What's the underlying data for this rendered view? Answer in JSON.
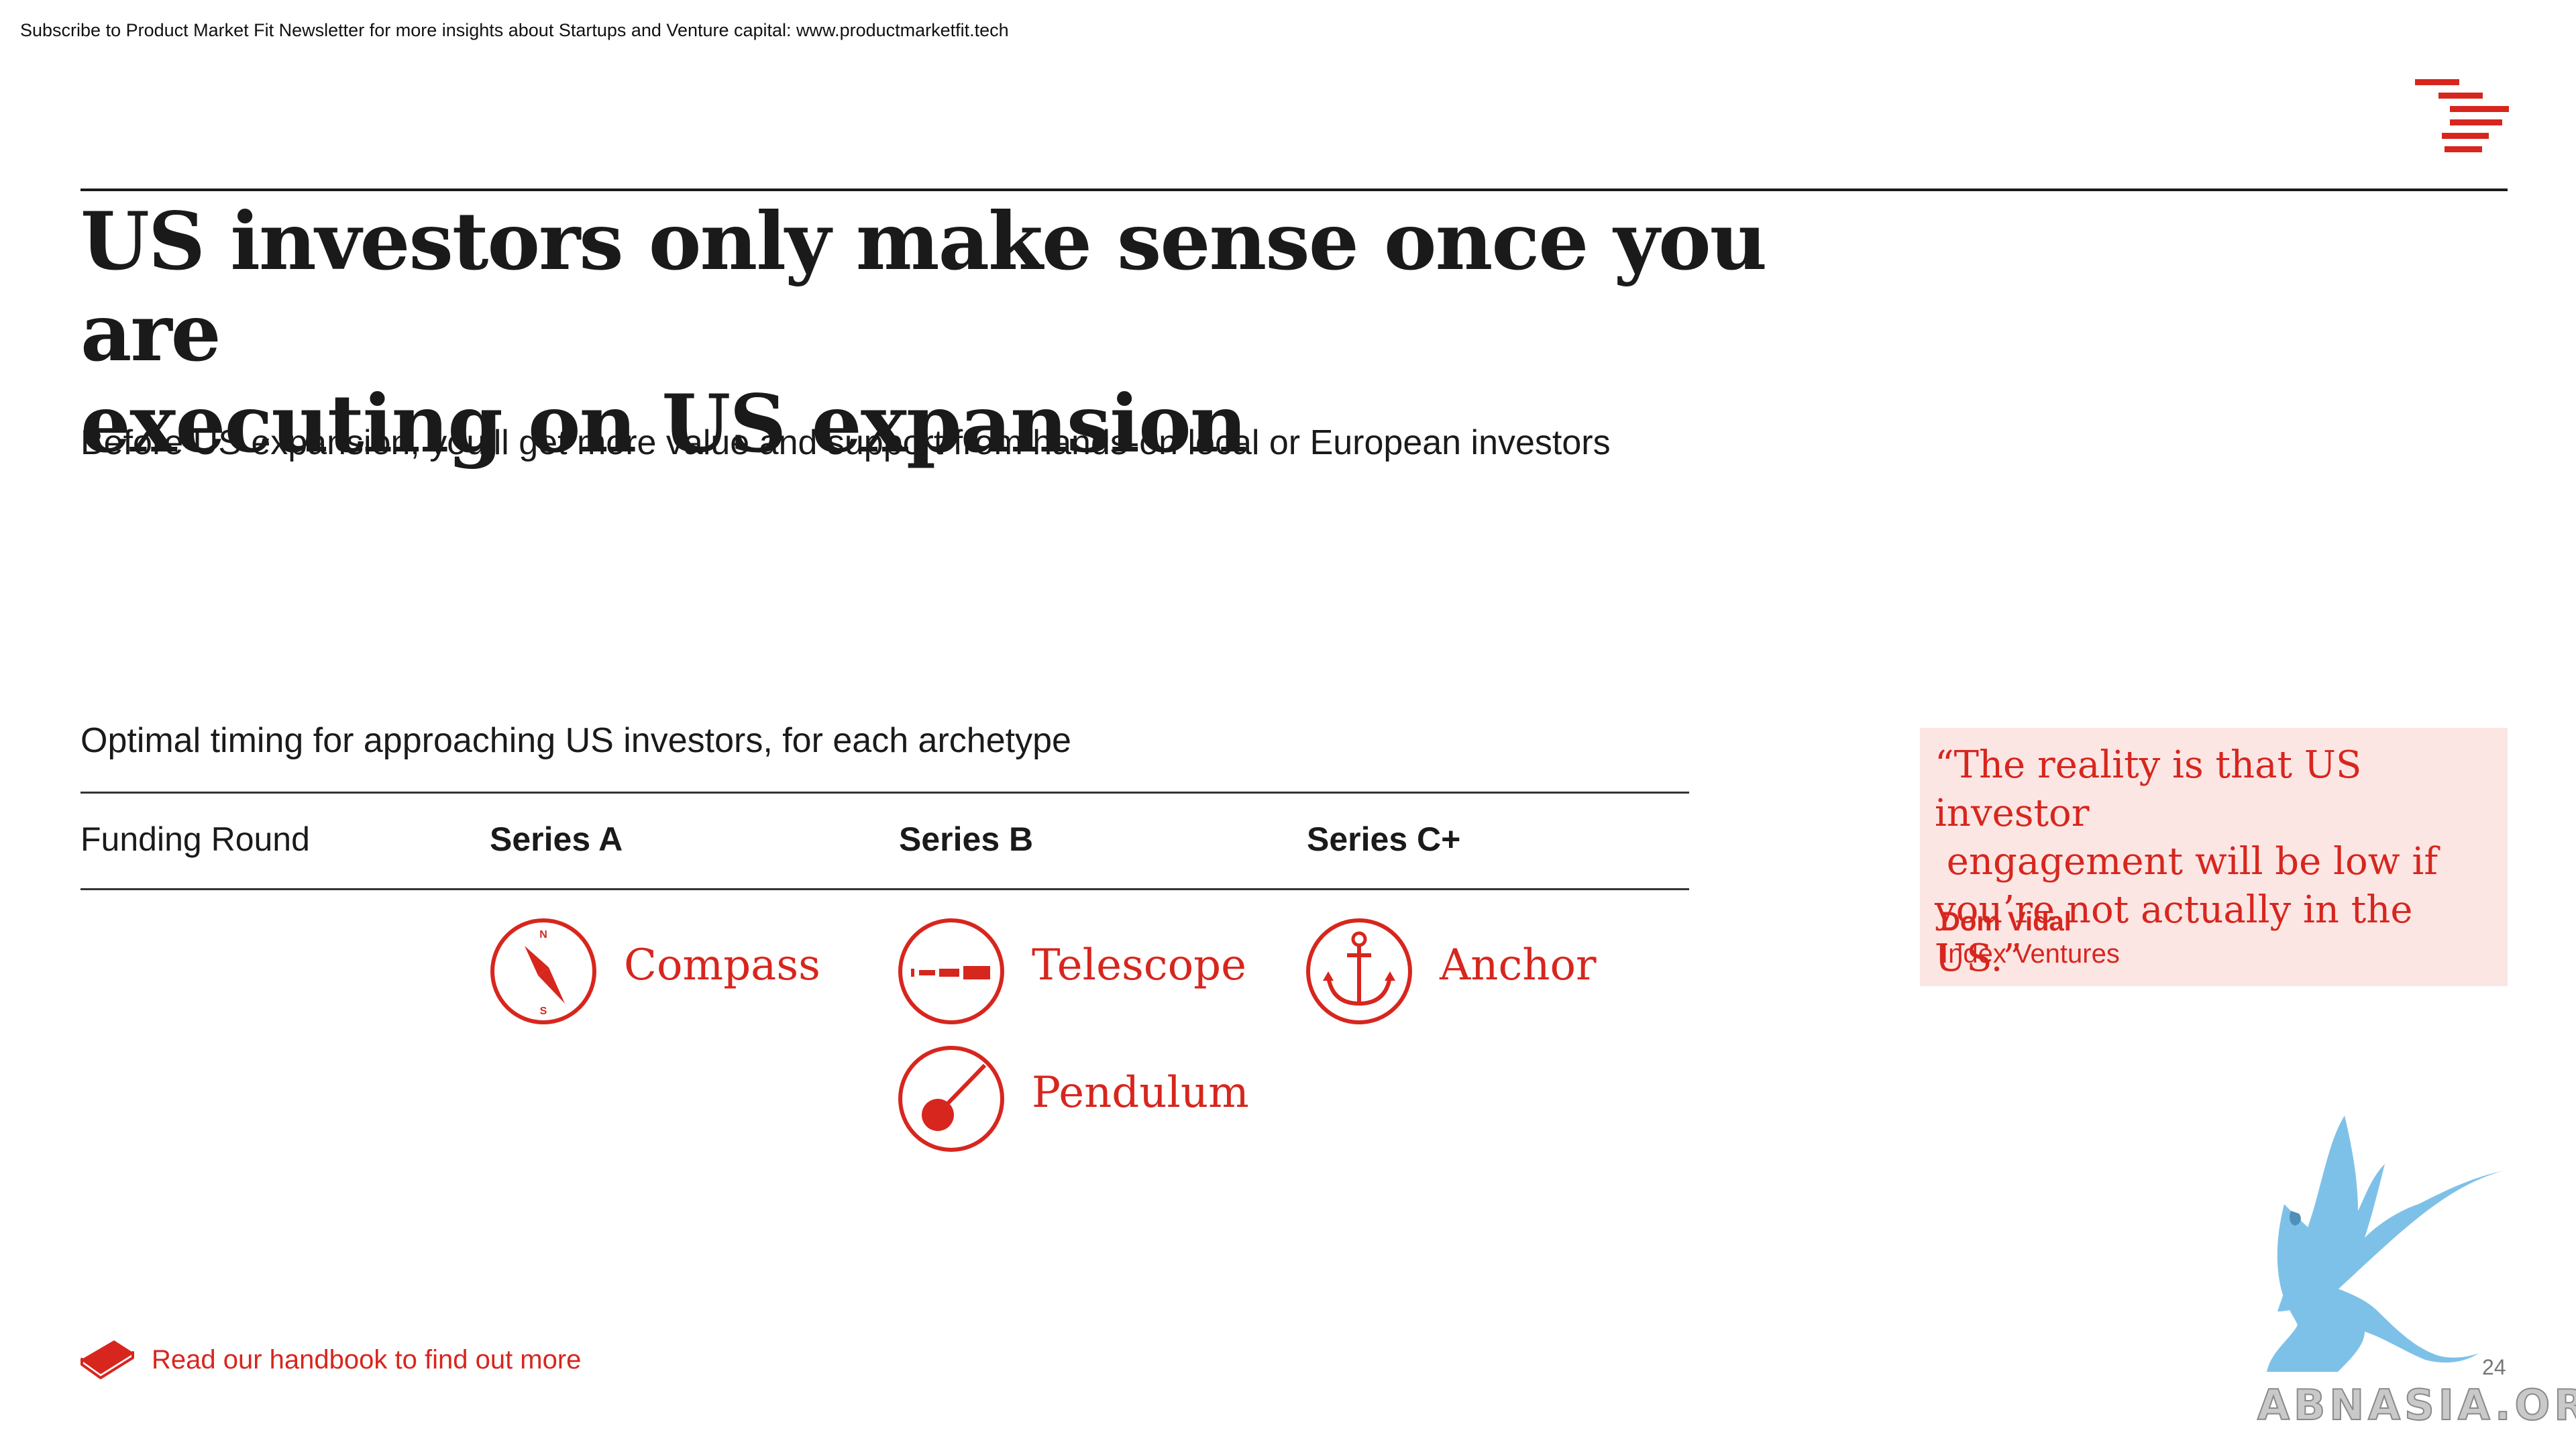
{
  "newsletter_banner": "Subscribe to Product Market Fit Newsletter for more insights about Startups and Venture capital:  www.productmarketfit.tech",
  "brand": {
    "logo_icon": "index-ventures-stripes-icon",
    "accent_color": "#d7261e"
  },
  "header": {
    "title_line1": "US investors only make sense once you are",
    "title_line2": "executing on US expansion",
    "subtitle": "Before US expansion, you’ll get more value and support from hands-on local or European investors"
  },
  "timing_table": {
    "heading": "Optimal timing for approaching US investors, for each archetype",
    "row_label": "Funding Round",
    "columns": [
      {
        "round": "Series A",
        "archetypes": [
          {
            "name": "Compass",
            "icon": "compass-icon"
          }
        ]
      },
      {
        "round": "Series B",
        "archetypes": [
          {
            "name": "Telescope",
            "icon": "telescope-icon"
          },
          {
            "name": "Pendulum",
            "icon": "pendulum-icon"
          }
        ]
      },
      {
        "round": "Series C+",
        "archetypes": [
          {
            "name": "Anchor",
            "icon": "anchor-icon"
          }
        ]
      }
    ],
    "compass_north": "N",
    "compass_south": "S"
  },
  "quote": {
    "line1": "“The reality is that US investor",
    "line2": " engagement will be low if",
    "line3": "you’re not actually in the US.”",
    "author": "Dom Vidal",
    "organization": "Index Ventures",
    "background_color": "#fbe6e4"
  },
  "footer": {
    "handbook_link": "Read our handbook to find out more",
    "handbook_icon": "book-icon",
    "page_number": "24"
  },
  "watermark": {
    "text": "ABNASIA.ORG",
    "icon": "griffin-logo-icon"
  }
}
